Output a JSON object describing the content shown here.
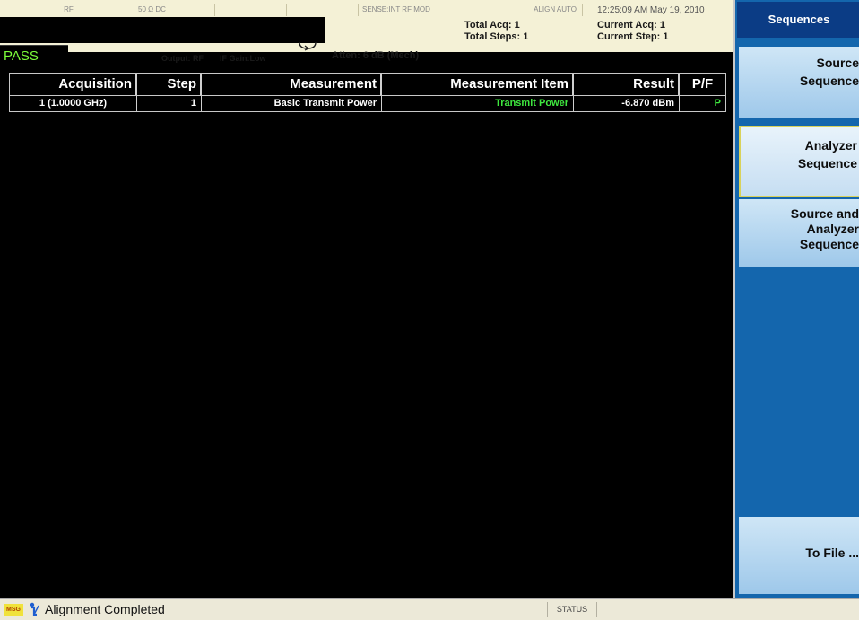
{
  "header": {
    "strip": [
      "RF",
      "50 Ω  DC",
      "",
      "",
      "",
      "SENSE:INT  RF  MOD",
      "ALIGN AUTO"
    ],
    "datetime": "12:25:09 AM May 19, 2010",
    "total_acq": "Total Acq: 1",
    "total_steps": "Total Steps: 1",
    "current_acq": "Current Acq: 1",
    "current_step": "Current Step: 1",
    "pass_label": "PASS",
    "output": "Output: RF",
    "if_gain": "IF Gain:Low",
    "atten": "Atten: 6 dB (Mech)"
  },
  "table": {
    "columns": [
      "Acquisition",
      "Step",
      "Measurement",
      "Measurement Item",
      "Result",
      "P/F"
    ],
    "rows": [
      {
        "acquisition": "1 (1.0000 GHz)",
        "step": "1",
        "measurement": "Basic Transmit Power",
        "item": "Transmit Power",
        "result": "-6.870 dBm",
        "pf": "P"
      }
    ]
  },
  "side_panel": {
    "title": "Sequences",
    "keys": [
      {
        "lines": [
          "Source",
          "Sequence"
        ]
      },
      {
        "lines": [
          "Analyzer",
          "Sequence"
        ]
      },
      {
        "lines": [
          "Source and",
          "Analyzer",
          "Sequence"
        ]
      },
      {
        "lines": [
          "To File ..."
        ]
      }
    ]
  },
  "status_bar": {
    "msg_badge": "MSG",
    "message": "Alignment Completed",
    "status_label": "STATUS"
  },
  "colors": {
    "pass_green": "#7dff3a",
    "result_green": "#3fe83f",
    "panel_blue": "#1466ad",
    "title_blue": "#0b3c85"
  }
}
